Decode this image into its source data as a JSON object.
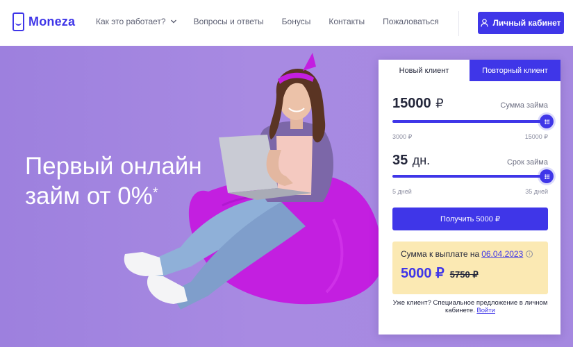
{
  "header": {
    "logo_text": "Moneza",
    "nav": [
      {
        "label": "Как это работает?"
      },
      {
        "label": "Вопросы и ответы"
      },
      {
        "label": "Бонусы"
      },
      {
        "label": "Контакты"
      },
      {
        "label": "Пожаловаться"
      }
    ],
    "cabinet_label": "Личный кабинет"
  },
  "hero": {
    "title_line1": "Первый онлайн",
    "title_line2": "займ от 0%",
    "title_mark": "*"
  },
  "calculator": {
    "tabs": [
      {
        "label": "Новый клиент",
        "active": true
      },
      {
        "label": "Повторный клиент",
        "active": false
      }
    ],
    "amount": {
      "value": "15000",
      "currency": "₽",
      "label": "Сумма займа",
      "min": "3000 ₽",
      "max": "15000 ₽",
      "slider_fraction": 1.0
    },
    "term": {
      "value": "35",
      "unit": "дн.",
      "label": "Срок займа",
      "min": "5 дней",
      "max": "35 дней",
      "slider_fraction": 1.0
    },
    "submit_label": "Получить 5000 ₽",
    "payout": {
      "label": "Сумма к выплате на",
      "date": "06.04.2023",
      "info_glyph": "i",
      "new_sum": "5000 ₽",
      "old_sum": "5750 ₽"
    },
    "promo_text": "Уже клиент? Специальное предложение в личном кабинете.",
    "promo_link": "Войти"
  },
  "colors": {
    "accent": "#3f36e8",
    "hero_bg": "#a286e0",
    "payout_bg": "#fbe9b3",
    "beanbag": "#c31fe0"
  }
}
